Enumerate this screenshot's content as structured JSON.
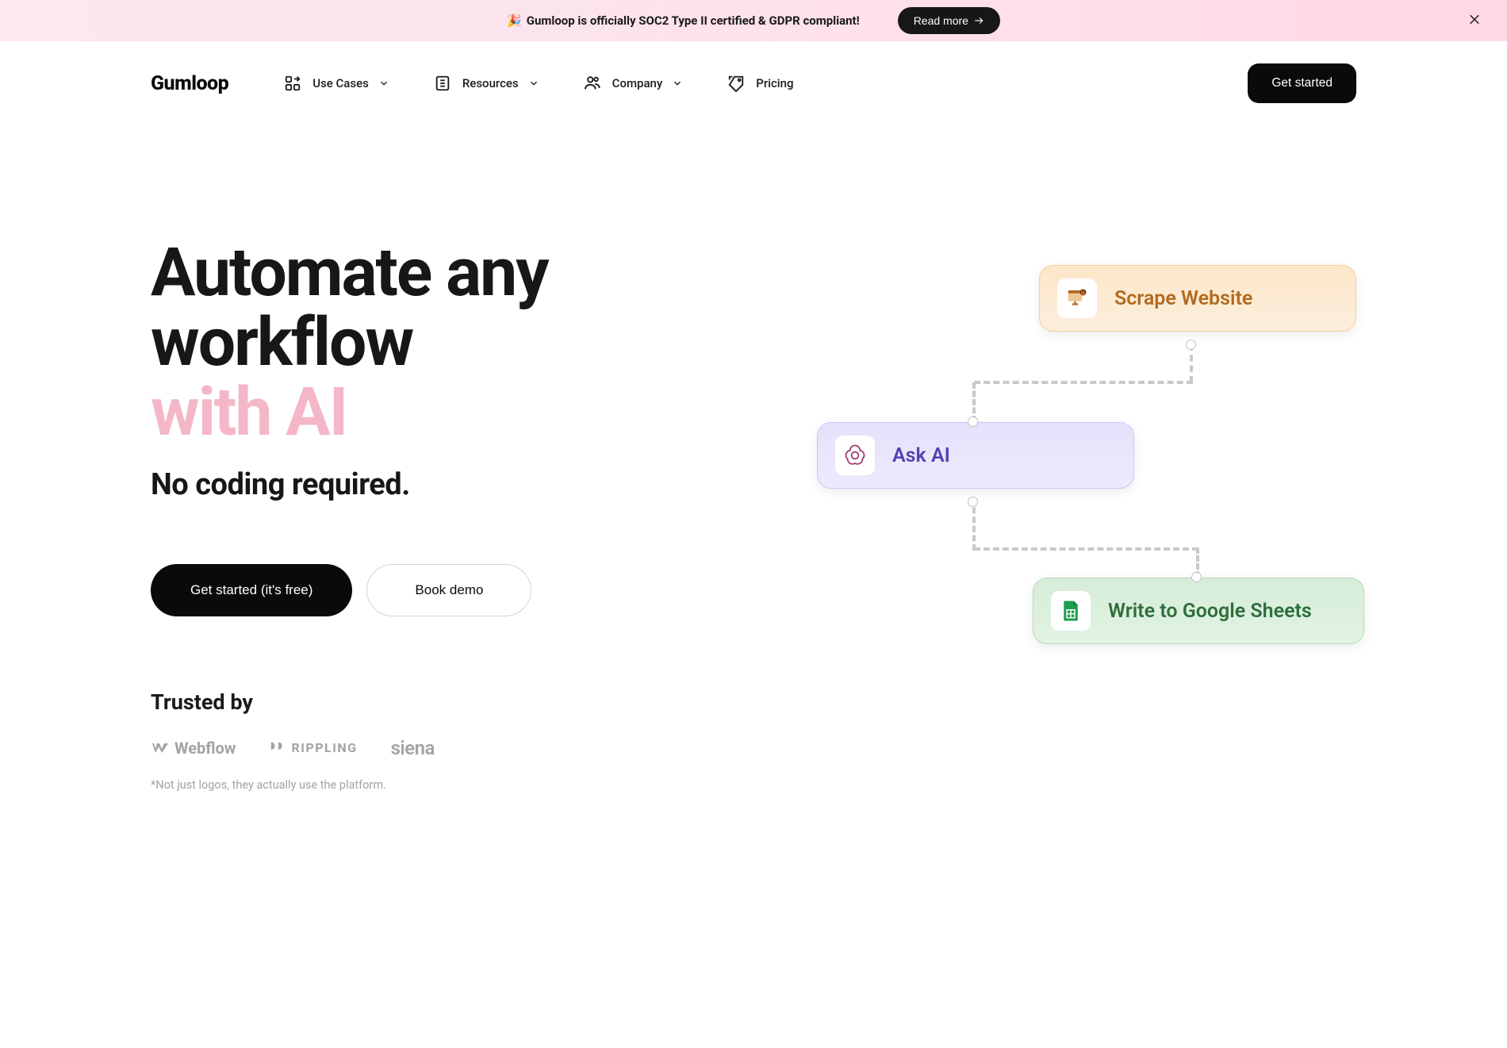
{
  "banner": {
    "emoji": "🎉",
    "text": "Gumloop is officially SOC2 Type II certified & GDPR compliant!",
    "cta": "Read more"
  },
  "brand": {
    "name": "Gumloop"
  },
  "nav": {
    "use_cases": "Use Cases",
    "resources": "Resources",
    "company": "Company",
    "pricing": "Pricing",
    "get_started": "Get started"
  },
  "hero": {
    "title_line1": "Automate any",
    "title_line2": "workflow",
    "title_accent": "with AI",
    "subtitle": "No coding required.",
    "cta_primary": "Get started (it's free)",
    "cta_secondary": "Book demo"
  },
  "trusted": {
    "title": "Trusted by",
    "logos": {
      "webflow": "Webflow",
      "rippling": "RIPPLING",
      "siena": "siena"
    },
    "note": "*Not just logos, they actually use the platform."
  },
  "workflow_cards": {
    "scrape": "Scrape Website",
    "askai": "Ask AI",
    "sheets": "Write to Google Sheets"
  },
  "colors": {
    "text": "#0a0a0a",
    "accent_pink": "#f4b7c8",
    "banner_bg": "#fce4ec",
    "card_orange": "#b26a20",
    "card_purple": "#5641b3",
    "card_green": "#2d6f3a"
  }
}
